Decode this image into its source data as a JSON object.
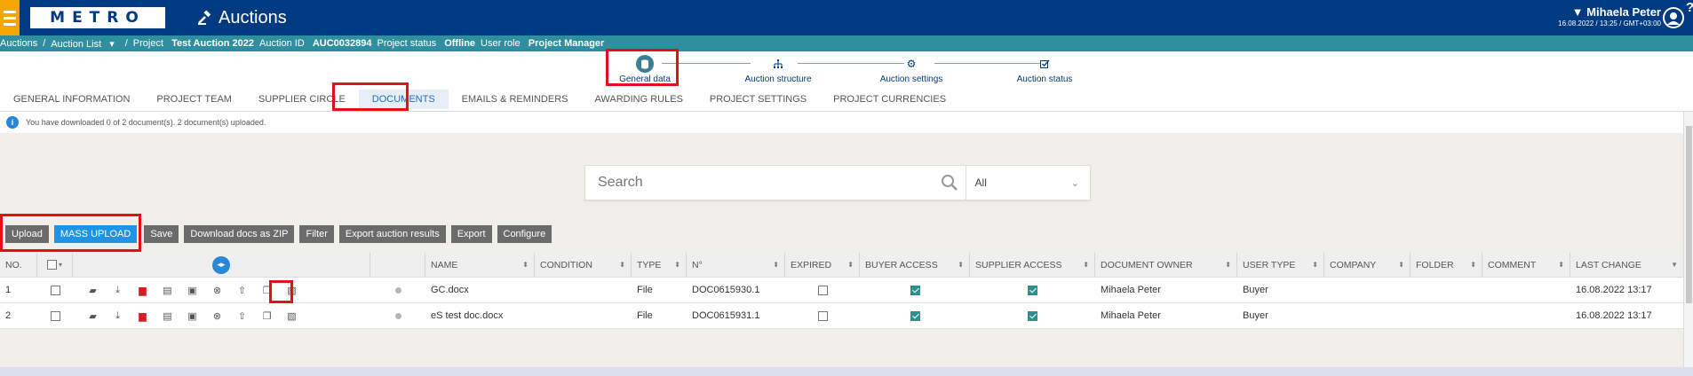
{
  "topbar": {
    "logo": "METRO",
    "app_title": "Auctions",
    "user_name": "Mihaela Peter",
    "user_datetime": "16.08.2022 / 13:25 / GMT+03:00",
    "help": "?",
    "accent_color": "#f6a500",
    "brand_color": "#003a80"
  },
  "breadcrumb": {
    "root": "Auctions",
    "sep": "/",
    "list": "Auction List",
    "project_label": "Project",
    "project_value": "Test Auction 2022",
    "id_label": "Auction ID",
    "id_value": "AUC0032894",
    "status_label": "Project status",
    "status_value": "Offline",
    "role_label": "User role",
    "role_value": "Project Manager"
  },
  "steps": [
    {
      "label": "General data",
      "icon": "database-icon"
    },
    {
      "label": "Auction structure",
      "icon": "hierarchy-icon"
    },
    {
      "label": "Auction settings",
      "icon": "gear-icon"
    },
    {
      "label": "Auction status",
      "icon": "check-edit-icon"
    }
  ],
  "tabs": [
    {
      "label": "GENERAL INFORMATION"
    },
    {
      "label": "PROJECT TEAM"
    },
    {
      "label": "SUPPLIER CIRCLE"
    },
    {
      "label": "DOCUMENTS"
    },
    {
      "label": "EMAILS & REMINDERS"
    },
    {
      "label": "AWARDING RULES"
    },
    {
      "label": "PROJECT SETTINGS"
    },
    {
      "label": "PROJECT CURRENCIES"
    }
  ],
  "info": {
    "icon": "info-icon",
    "text": "You have downloaded 0 of 2 document(s). 2 document(s) uploaded."
  },
  "search": {
    "placeholder": "Search",
    "filter_value": "All"
  },
  "toolbar": {
    "upload": "Upload",
    "mass_upload": "MASS UPLOAD",
    "save": "Save",
    "download_zip": "Download docs as ZIP",
    "filter": "Filter",
    "export_results": "Export auction results",
    "export": "Export",
    "configure": "Configure"
  },
  "table": {
    "headers": {
      "no": "NO.",
      "name": "NAME",
      "condition": "CONDITION",
      "type": "TYPE",
      "number": "N°",
      "expired": "EXPIRED",
      "buyer_access": "BUYER ACCESS",
      "supplier_access": "SUPPLIER ACCESS",
      "owner": "DOCUMENT OWNER",
      "user_type": "USER TYPE",
      "company": "COMPANY",
      "folder": "FOLDER",
      "comment": "COMMENT",
      "last_change": "LAST CHANGE"
    },
    "rows": [
      {
        "no": "1",
        "name": "GC.docx",
        "condition": "",
        "type": "File",
        "number": "DOC0615930.1",
        "expired": false,
        "buyer_access": true,
        "supplier_access": true,
        "owner": "Mihaela Peter",
        "user_type": "Buyer",
        "company": "",
        "folder": "",
        "comment": "",
        "last_change": "16.08.2022 13:17"
      },
      {
        "no": "2",
        "name": "eS test doc.docx",
        "condition": "",
        "type": "File",
        "number": "DOC0615931.1",
        "expired": false,
        "buyer_access": true,
        "supplier_access": true,
        "owner": "Mihaela Peter",
        "user_type": "Buyer",
        "company": "",
        "folder": "",
        "comment": "",
        "last_change": "16.08.2022 13:17"
      }
    ]
  }
}
